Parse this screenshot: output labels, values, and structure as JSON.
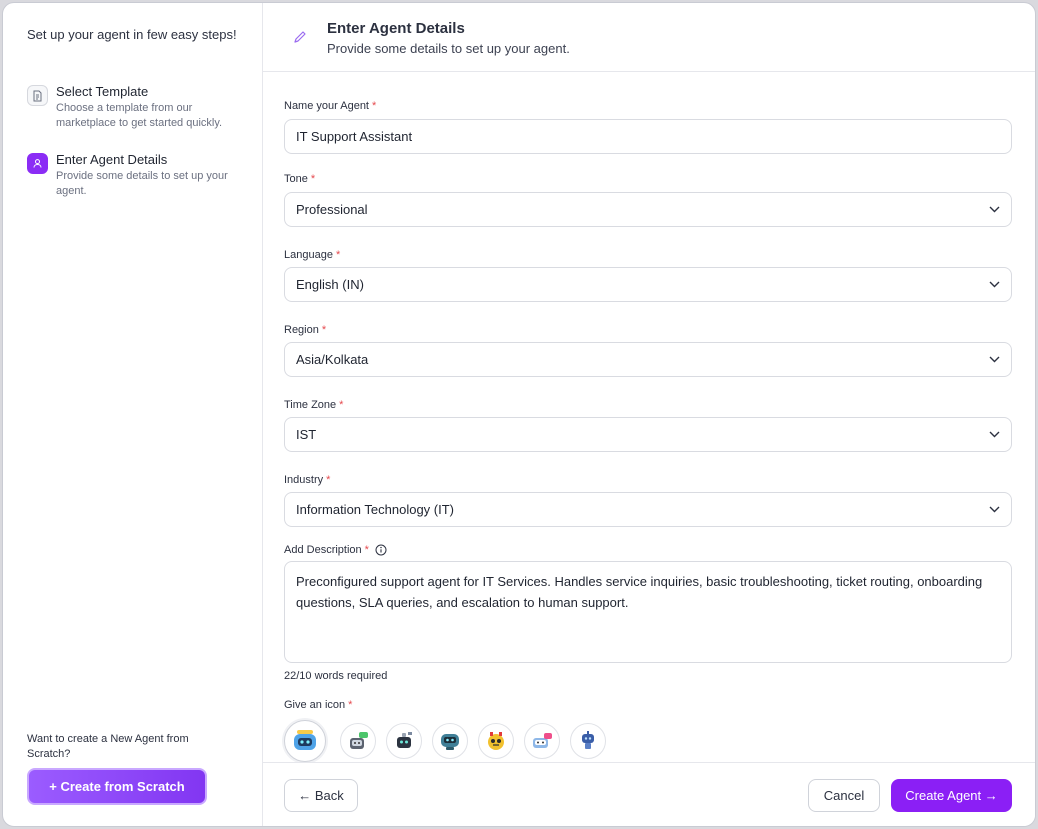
{
  "sidebar": {
    "title": "Set up your agent in few easy steps!",
    "steps": [
      {
        "name": "Select Template",
        "desc": "Choose a template from our marketplace to get started quickly."
      },
      {
        "name": "Enter Agent Details",
        "desc": "Provide some details to set up your agent."
      }
    ],
    "footer_text": "Want to create a New Agent from Scratch?",
    "scratch_button": "+ Create from Scratch"
  },
  "header": {
    "title": "Enter Agent Details",
    "subtitle": "Provide some details to set up your agent."
  },
  "form": {
    "name": {
      "label": "Name your Agent",
      "value": "IT Support Assistant"
    },
    "tone": {
      "label": "Tone",
      "value": "Professional"
    },
    "language": {
      "label": "Language",
      "value": "English (IN)"
    },
    "region": {
      "label": "Region",
      "value": "Asia/Kolkata"
    },
    "timezone": {
      "label": "Time Zone",
      "value": "IST"
    },
    "industry": {
      "label": "Industry",
      "value": "Information Technology (IT)"
    },
    "description": {
      "label": "Add Description",
      "value": "Preconfigured support agent for IT Services. Handles service inquiries, basic troubleshooting, ticket routing, onboarding questions, SLA queries, and escalation to human support.",
      "word_count": "22/10 words required"
    },
    "icon": {
      "label": "Give an icon"
    },
    "required_mark": "*"
  },
  "footer": {
    "back": "← Back",
    "cancel": "Cancel",
    "create": "Create Agent →"
  },
  "colors": {
    "accent": "#8b1ff5",
    "required": "#e5484d"
  }
}
